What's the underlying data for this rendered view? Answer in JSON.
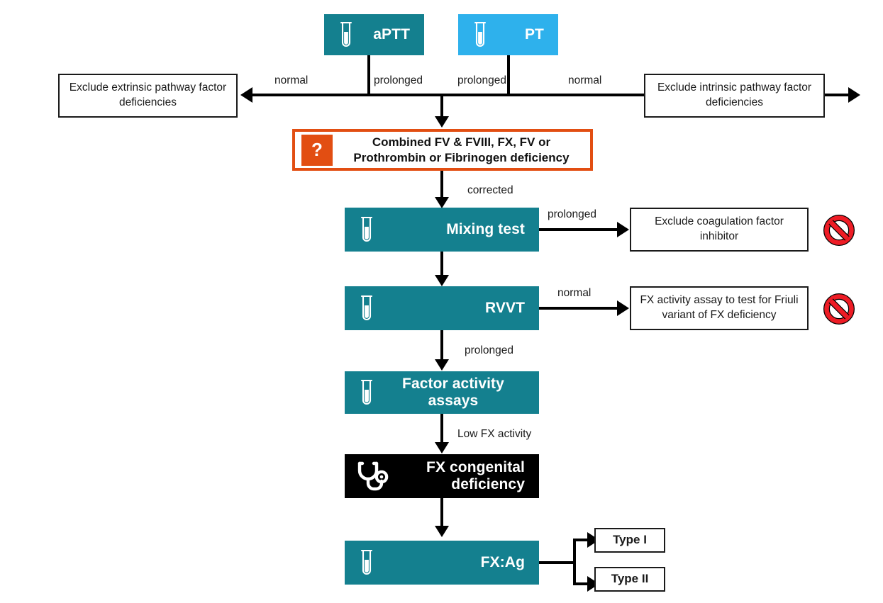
{
  "diagram": {
    "title": "FX congenital deficiency diagnostic algorithm",
    "colors": {
      "teal": "#14808f",
      "blue": "#2eb1ec",
      "orange": "#e24e12",
      "black": "#000000",
      "red": "#ee1c25",
      "outline": "#1a1a1a"
    }
  },
  "nodes": {
    "aptt": {
      "label": "aPTT",
      "icon": "test-tube-icon",
      "color": "#14808f"
    },
    "pt": {
      "label": "PT",
      "icon": "test-tube-icon",
      "color": "#2eb1ec"
    },
    "exclude_extrinsic": {
      "label": "Exclude extrinsic pathway factor deficiencies"
    },
    "exclude_intrinsic": {
      "label": "Exclude intrinsic pathway factor deficiencies"
    },
    "combined": {
      "badge": "?",
      "label": "Combined FV & FVIII, FX, FV or Prothrombin or Fibrinogen deficiency"
    },
    "mixing_test": {
      "label": "Mixing test",
      "icon": "test-tube-icon",
      "color": "#14808f"
    },
    "exclude_inhibitor": {
      "label": "Exclude coagulation factor inhibitor"
    },
    "rvvt": {
      "label": "RVVT",
      "icon": "test-tube-icon",
      "color": "#14808f"
    },
    "friuli": {
      "label": "FX activity assay to test for Friuli variant of FX deficiency"
    },
    "factor_activity": {
      "label": "Factor activity assays",
      "icon": "test-tube-icon",
      "color": "#14808f"
    },
    "fx_congenital": {
      "label": "FX congenital deficiency",
      "icon": "stethoscope-icon",
      "color": "#000000"
    },
    "fx_ag": {
      "label": "FX:Ag",
      "icon": "test-tube-icon",
      "color": "#14808f"
    },
    "type_i": {
      "label": "Type I"
    },
    "type_ii": {
      "label": "Type II"
    }
  },
  "edges": {
    "aptt_normal": "normal",
    "aptt_prolonged": "prolonged",
    "pt_prolonged": "prolonged",
    "pt_normal": "normal",
    "corrected": "corrected",
    "mixing_prolonged": "prolonged",
    "rvvt_normal": "normal",
    "rvvt_prolonged": "prolonged",
    "low_fx_activity": "Low FX activity"
  },
  "markers": {
    "no_inhibitor": "prohibition-icon",
    "no_friuli": "prohibition-icon"
  }
}
